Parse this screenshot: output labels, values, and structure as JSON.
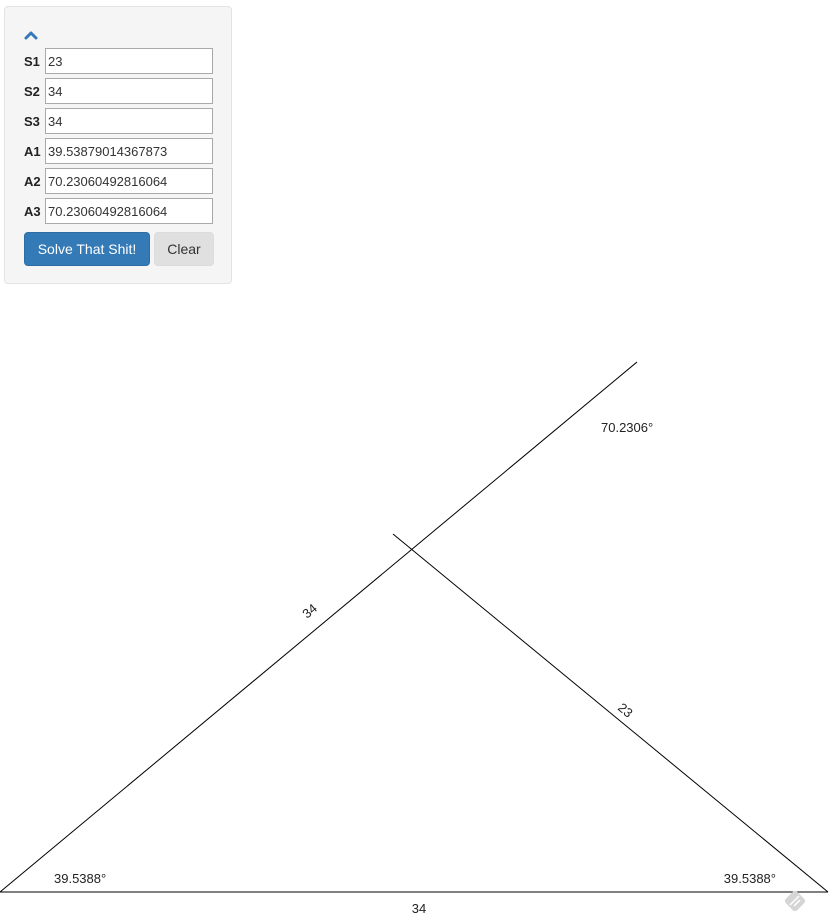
{
  "form": {
    "toggle_icon": "chevron-up-icon",
    "fields": [
      {
        "label": "S1",
        "value": "23"
      },
      {
        "label": "S2",
        "value": "34"
      },
      {
        "label": "S3",
        "value": "34"
      },
      {
        "label": "A1",
        "value": "39.53879014367873"
      },
      {
        "label": "A2",
        "value": "70.23060492816064"
      },
      {
        "label": "A3",
        "value": "70.23060492816064"
      }
    ],
    "solve_label": "Solve That Shit!",
    "clear_label": "Clear",
    "accent_color": "#337ab7"
  },
  "drawing": {
    "side_labels": {
      "base": "34",
      "left": "34",
      "right": "23"
    },
    "angle_labels": {
      "bottom_left": "39.5388°",
      "bottom_right": "39.5388°",
      "top": "70.2306°"
    },
    "corner_icon": "resize-grip-icon"
  }
}
